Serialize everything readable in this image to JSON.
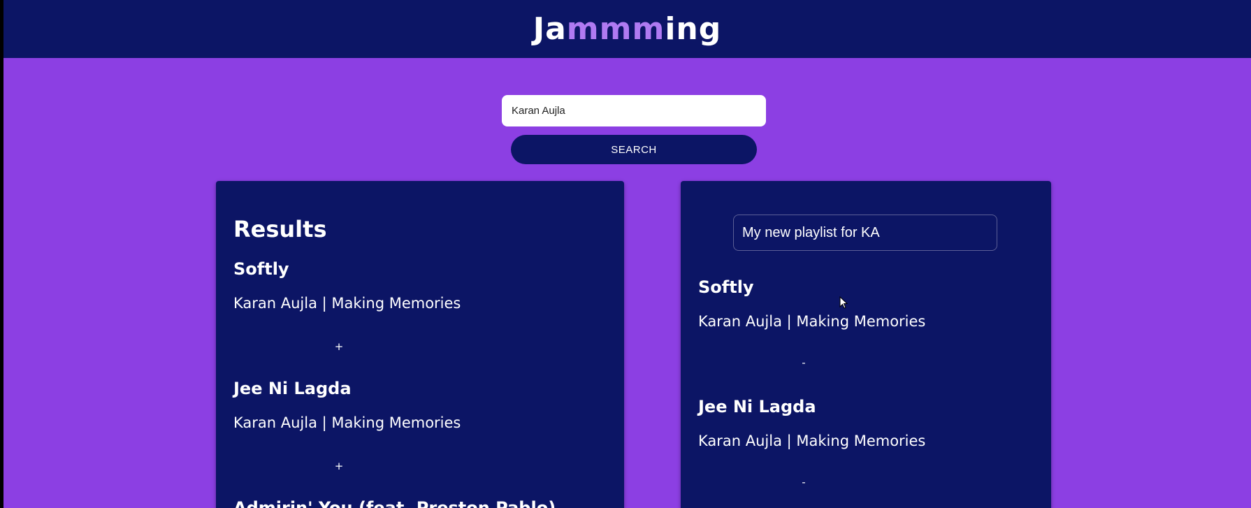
{
  "header": {
    "logo_prefix": "Ja",
    "logo_highlight": "mmm",
    "logo_suffix": "ing"
  },
  "search": {
    "value": "Karan Aujla",
    "button_label": "SEARCH"
  },
  "results": {
    "title": "Results",
    "tracks": [
      {
        "name": "Softly",
        "meta": "Karan Aujla | Making Memories",
        "action": "+"
      },
      {
        "name": "Jee Ni Lagda",
        "meta": "Karan Aujla | Making Memories",
        "action": "+"
      },
      {
        "name": "Admirin' You (feat. Preston Pablo)",
        "meta": "",
        "action": ""
      }
    ]
  },
  "playlist": {
    "name_value": "My new playlist for KA",
    "tracks": [
      {
        "name": "Softly",
        "meta": "Karan Aujla | Making Memories",
        "action": "-"
      },
      {
        "name": "Jee Ni Lagda",
        "meta": "Karan Aujla | Making Memories",
        "action": "-"
      }
    ]
  },
  "colors": {
    "background": "#8c3fe3",
    "header": "#0c1565",
    "panel": "#0c1565",
    "logo_highlight": "#b07af2"
  },
  "icons": {
    "cursor": "mouse-pointer-icon"
  }
}
